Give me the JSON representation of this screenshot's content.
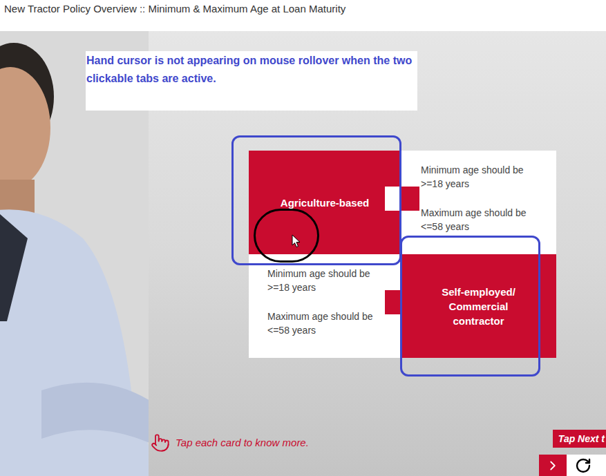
{
  "window": {
    "title": "New Tractor Policy Overview :: Minimum & Maximum Age at Loan Maturity"
  },
  "annotation": {
    "note": "Hand cursor is not appearing on mouse rollover when the two clickable tabs are active."
  },
  "cards": [
    {
      "label": "Agriculture-based",
      "details": [
        "Minimum age should be >=18 years",
        "Maximum age should be <=58 years"
      ]
    },
    {
      "label": "Self-employed/ Commercial contractor",
      "details": [
        "Minimum age should be >=18 years",
        "Maximum age should be <=58 years"
      ]
    }
  ],
  "instruction": "Tap each card to know more.",
  "next_hint": "Tap Next t"
}
